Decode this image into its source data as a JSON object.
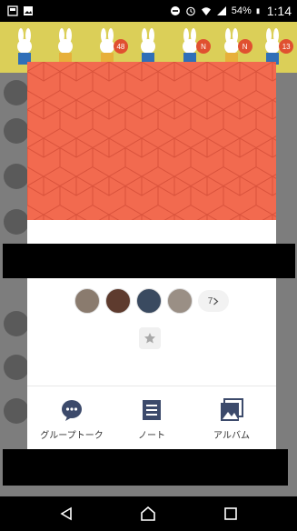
{
  "status_bar": {
    "battery": "54%",
    "time": "1:14"
  },
  "banner": {
    "badges": [
      "48",
      "N",
      "N",
      "13"
    ]
  },
  "group": {
    "more_members": "7",
    "more_members_icon": "chevron-right-icon",
    "favorite_icon": "star-icon"
  },
  "actions": [
    {
      "label": "グループトーク",
      "icon": "chat-bubble-icon"
    },
    {
      "label": "ノート",
      "icon": "note-icon"
    },
    {
      "label": "アルバム",
      "icon": "album-icon"
    }
  ],
  "colors": {
    "cover": "#f26a4f",
    "action_icon": "#3c4a6b"
  }
}
